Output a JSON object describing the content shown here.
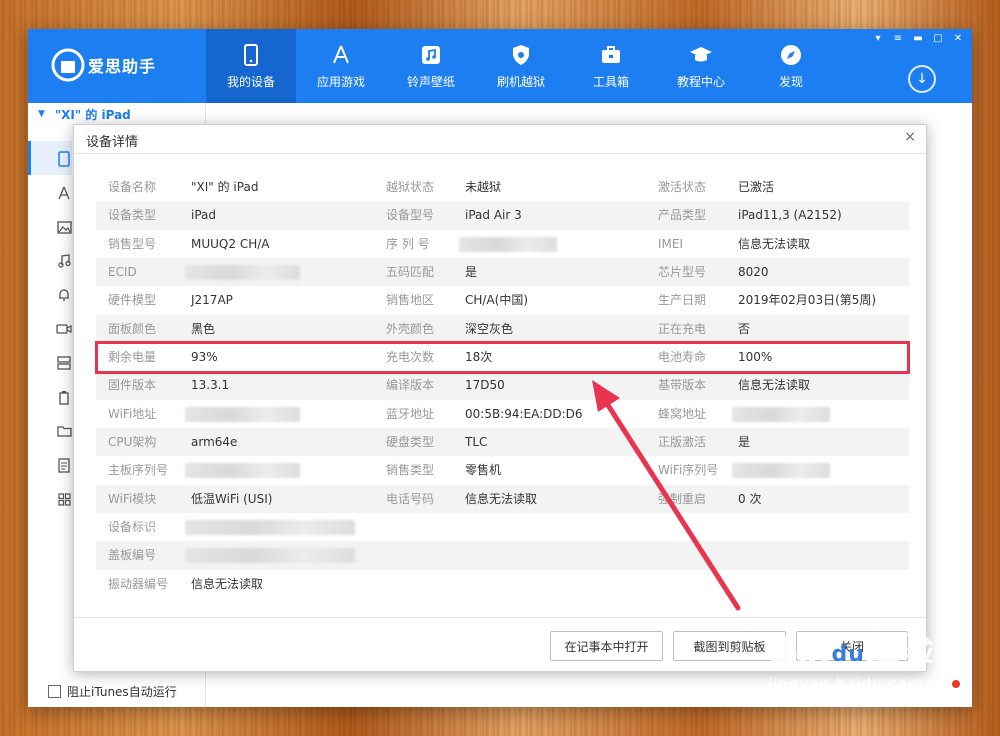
{
  "app": {
    "logo_text": "爱思助手",
    "nav": [
      {
        "label": "我的设备",
        "icon": "phone-icon",
        "active": true
      },
      {
        "label": "应用游戏",
        "icon": "app-store-icon"
      },
      {
        "label": "铃声壁纸",
        "icon": "music-icon"
      },
      {
        "label": "刷机越狱",
        "icon": "shield-icon"
      },
      {
        "label": "工具箱",
        "icon": "toolbox-icon"
      },
      {
        "label": "教程中心",
        "icon": "graduation-cap-icon"
      },
      {
        "label": "发现",
        "icon": "compass-icon"
      }
    ],
    "window_controls": [
      "shirt-icon",
      "menu-icon",
      "minimize-icon",
      "maximize-icon",
      "close-icon"
    ],
    "download_icon": "download-icon"
  },
  "sidebar": {
    "device_name": "\"XI\" 的 iPad",
    "items": [
      "phone-icon",
      "app-store-icon",
      "image-icon",
      "music-icon",
      "bell-icon",
      "video-icon",
      "database-icon",
      "battery-icon",
      "folder-icon",
      "document-icon",
      "grid-icon"
    ],
    "bottom_checkbox_label": "阻止iTunes自动运行"
  },
  "dialog": {
    "title": "设备详情",
    "close": "×",
    "rows": [
      [
        {
          "label": "设备名称",
          "value": "\"XI\" 的 iPad"
        },
        {
          "label": "越狱状态",
          "value": "未越狱"
        },
        {
          "label": "激活状态",
          "value": "已激活"
        }
      ],
      [
        {
          "label": "设备类型",
          "value": "iPad"
        },
        {
          "label": "设备型号",
          "value": "iPad Air 3"
        },
        {
          "label": "产品类型",
          "value": "iPad11,3 (A2152)"
        }
      ],
      [
        {
          "label": "销售型号",
          "value": "MUUQ2 CH/A"
        },
        {
          "label": "序 列 号",
          "value": "",
          "blurred": true
        },
        {
          "label": "IMEI",
          "value": "信息无法读取"
        }
      ],
      [
        {
          "label": "ECID",
          "value": "",
          "blurred": true
        },
        {
          "label": "五码匹配",
          "value": "是"
        },
        {
          "label": "芯片型号",
          "value": "8020"
        }
      ],
      [
        {
          "label": "硬件模型",
          "value": "J217AP"
        },
        {
          "label": "销售地区",
          "value": "CH/A(中国)"
        },
        {
          "label": "生产日期",
          "value": "2019年02月03日(第5周)"
        }
      ],
      [
        {
          "label": "面板颜色",
          "value": "黑色"
        },
        {
          "label": "外壳颜色",
          "value": "深空灰色"
        },
        {
          "label": "正在充电",
          "value": "否"
        }
      ],
      [
        {
          "label": "剩余电量",
          "value": "93%"
        },
        {
          "label": "充电次数",
          "value": "18次"
        },
        {
          "label": "电池寿命",
          "value": "100%"
        }
      ],
      [
        {
          "label": "固件版本",
          "value": "13.3.1"
        },
        {
          "label": "编译版本",
          "value": "17D50"
        },
        {
          "label": "基带版本",
          "value": "信息无法读取"
        }
      ],
      [
        {
          "label": "WiFi地址",
          "value": "",
          "blurred": true
        },
        {
          "label": "蓝牙地址",
          "value": "00:5B:94:EA:DD:D6"
        },
        {
          "label": "蜂窝地址",
          "value": "",
          "blurred": true
        }
      ],
      [
        {
          "label": "CPU架构",
          "value": "arm64e"
        },
        {
          "label": "硬盘类型",
          "value": "TLC"
        },
        {
          "label": "正版激活",
          "value": "是"
        }
      ],
      [
        {
          "label": "主板序列号",
          "value": "",
          "blurred": true
        },
        {
          "label": "销售类型",
          "value": "零售机"
        },
        {
          "label": "WiFi序列号",
          "value": "",
          "blurred": true
        }
      ],
      [
        {
          "label": "WiFi模块",
          "value": "低温WiFi (USI)"
        },
        {
          "label": "电话号码",
          "value": "信息无法读取"
        },
        {
          "label": "强制重启",
          "value": "0 次"
        }
      ],
      [
        {
          "label": "设备标识",
          "value": "",
          "blurred": true
        }
      ],
      [
        {
          "label": "盖板编号",
          "value": "",
          "blurred": true
        }
      ],
      [
        {
          "label": "振动器编号",
          "value": "信息无法读取"
        }
      ]
    ],
    "buttons": {
      "open_notepad": "在记事本中打开",
      "screenshot_clipboard": "截图到剪贴板",
      "close": "关闭"
    }
  },
  "annotation": {
    "highlight_color": "#e8344e",
    "arrow_color": "#e8344e"
  },
  "watermark": {
    "brand": "Bai",
    "paw": "du",
    "suffix": "经验",
    "url": "jingyan.baidu.com"
  }
}
